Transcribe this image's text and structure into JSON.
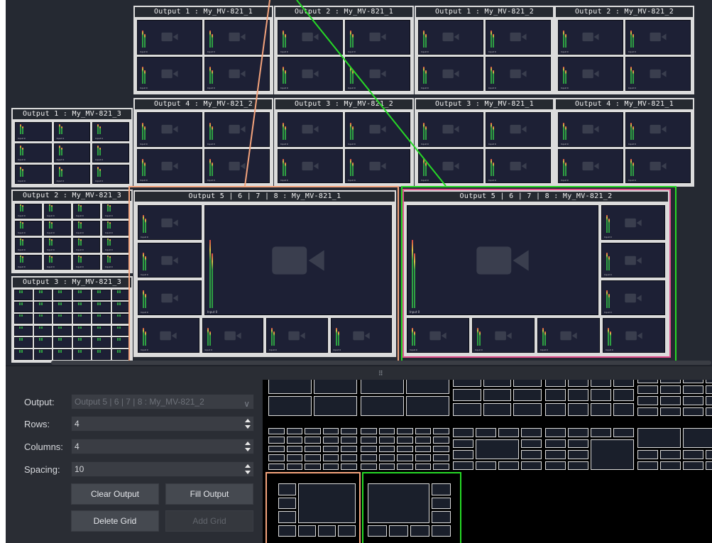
{
  "outputs": {
    "o1_mv1": "Output 1 : My_MV-821_1",
    "o2_mv1": "Output 2 : My_MV-821_1",
    "o1_mv2": "Output 1 : My_MV-821_2",
    "o2_mv2": "Output 2 : My_MV-821_2",
    "o4_mv2": "Output 4 : My_MV-821_2",
    "o3_mv2": "Output 3 : My_MV-821_2",
    "o3_mv1": "Output 3 : My_MV-821_1",
    "o4_mv1": "Output 4 : My_MV-821_1",
    "o1_mv3": "Output 1 : My_MV-821_3",
    "o2_mv3": "Output 2 : My_MV-821_3",
    "o3_mv3": "Output 3 : My_MV-821_3",
    "o5678_mv1": "Output 5 | 6 | 7 | 8 : My_MV-821_1",
    "o5678_mv2": "Output 5 | 6 | 7 | 8 : My_MV-821_2"
  },
  "tile_label": "Input 0",
  "form": {
    "output_label": "Output:",
    "output_value": "Output 5 | 6 | 7 | 8 : My_MV-821_2",
    "rows_label": "Rows:",
    "rows_value": "4",
    "columns_label": "Columns:",
    "columns_value": "4",
    "spacing_label": "Spacing:",
    "spacing_value": "10",
    "clear_output": "Clear Output",
    "fill_output": "Fill Output",
    "delete_grid": "Delete Grid",
    "add_grid": "Add Grid"
  },
  "colors": {
    "highlight_orange": "#f4a37c",
    "highlight_green": "#26d926",
    "selection_pink": "#e0508c"
  }
}
